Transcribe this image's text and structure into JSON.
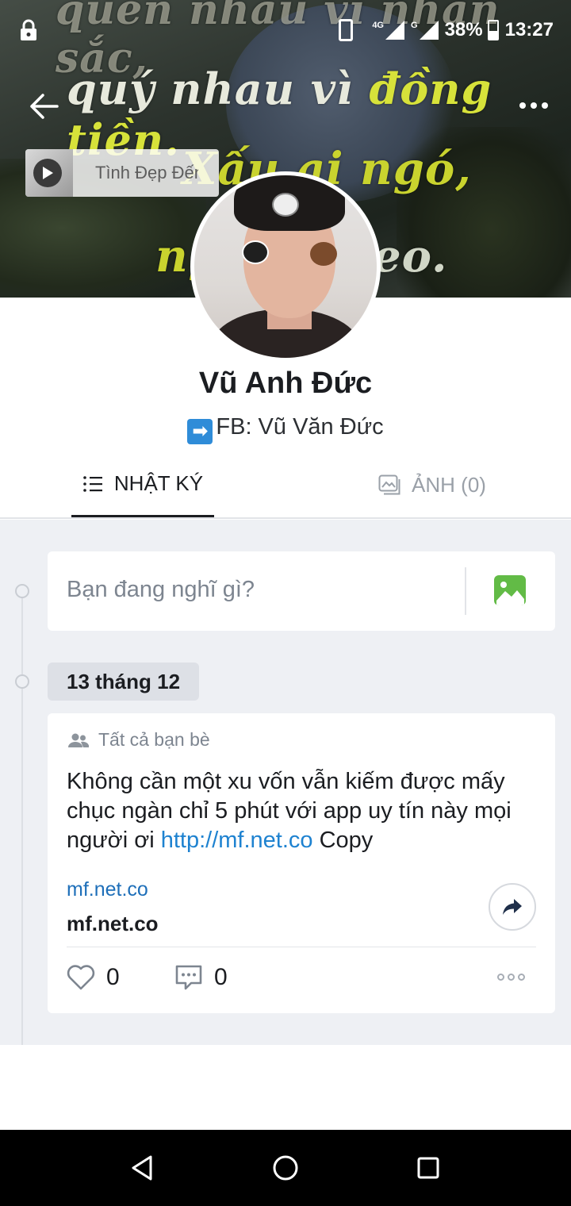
{
  "status": {
    "network_1": "4G",
    "network_2": "G",
    "battery": "38%",
    "time": "13:27"
  },
  "cover": {
    "line1": "quên nhau vì nhan sắc,",
    "line2_a": "quý nhau vì ",
    "line2_b": "đồng tiền.",
    "line3": "Xấu ai ngó,",
    "line4": "ng",
    "line5": "eo."
  },
  "music": {
    "title": "Tình Đẹp Đến"
  },
  "profile": {
    "name": "Vũ Anh Đức",
    "bio_arrow": "➡",
    "bio": "FB: Vũ Văn Đức"
  },
  "tabs": [
    {
      "label": "NHẬT KÝ",
      "active": true
    },
    {
      "label": "ẢNH (0)",
      "active": false
    }
  ],
  "composer": {
    "placeholder": "Bạn đang nghĩ gì?"
  },
  "feed": {
    "date": "13 tháng 12",
    "post": {
      "privacy": "Tất cả bạn bè",
      "text_before": "Không cần một xu vốn vẫn kiếm được mấy chục ngàn chỉ 5 phút với app uy tín này mọi người ơi ",
      "link": "http://mf.net.co",
      "text_after": " Copy",
      "link_domain": "mf.net.co",
      "link_title": "mf.net.co",
      "likes": "0",
      "comments": "0"
    }
  },
  "colors": {
    "accent_link": "#1e82d0",
    "feed_bg": "#eef0f4",
    "photo_icon": "#62bb46"
  }
}
